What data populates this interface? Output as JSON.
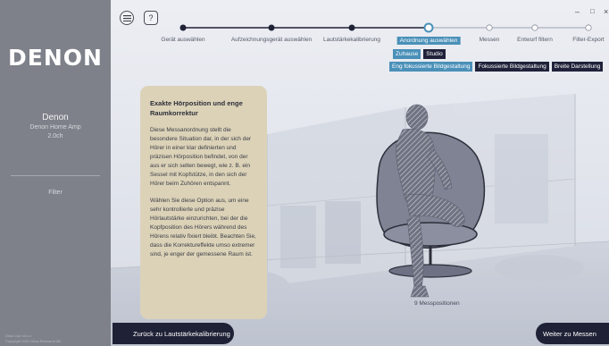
{
  "sidebar": {
    "logo": "DENON",
    "device_name": "Denon",
    "device_model": "Denon Home Amp",
    "channels": "2.0ch",
    "filter_label": "Filter",
    "version_line1": "Dirac Live v3.x.x",
    "version_line2": "Copyright 2021 Dirac Research AB"
  },
  "topbar": {
    "menu_icon": "menu-icon",
    "help_label": "?",
    "window_min": "–",
    "window_max": "□",
    "window_close": "×"
  },
  "steps": [
    {
      "label": "Gerät auswählen",
      "state": "done"
    },
    {
      "label": "Aufzeichnungsgerät auswählen",
      "state": "done"
    },
    {
      "label": "Lautstärkekalibrierung",
      "state": "done"
    },
    {
      "label": "Anordnung auswählen",
      "state": "current"
    },
    {
      "label": "Messen",
      "state": "pending"
    },
    {
      "label": "Entwurf filtern",
      "state": "pending"
    },
    {
      "label": "Filter-Export",
      "state": "pending"
    }
  ],
  "location_options": [
    "Zuhause",
    "Studio"
  ],
  "location_selected": "Zuhause",
  "arrangement_options": [
    "Eng fokussierte Bildgestaltung",
    "Fokussierte Bildgestaltung",
    "Breite Darstellung"
  ],
  "arrangement_selected": "Eng fokussierte Bildgestaltung",
  "card": {
    "title": "Exakte Hörposition und enge Raumkorrektur",
    "paragraph1": "Diese Messanordnung stellt die besondere Situation dar, in der sich der Hörer in einer klar definierten und präzisen Hörposition befindet, von der aus er sich selten bewegt, wie z. B. ein Sessel mit Kopfstütze, in den sich der Hörer beim Zuhören entspannt.",
    "paragraph2": "Wählen Sie diese Option aus, um eine sehr kontrollierte und präzise Hörlautstärke einzurichten, bei der die Kopfposition des Hörers während des Hörens relativ fixiert bleibt. Beachten Sie, dass die Korrektureffekte umso extremer sind, je enger der gemessene Raum ist."
  },
  "positions_label": "9 Messpositionen",
  "buttons": {
    "back": "Zurück zu Lautstärkekalibrierung",
    "next": "Weiter zu Messen"
  },
  "colors": {
    "accent": "#4a90b8",
    "dark": "#20223a",
    "sidebar": "#7e8189",
    "card": "#dbd2b8"
  }
}
